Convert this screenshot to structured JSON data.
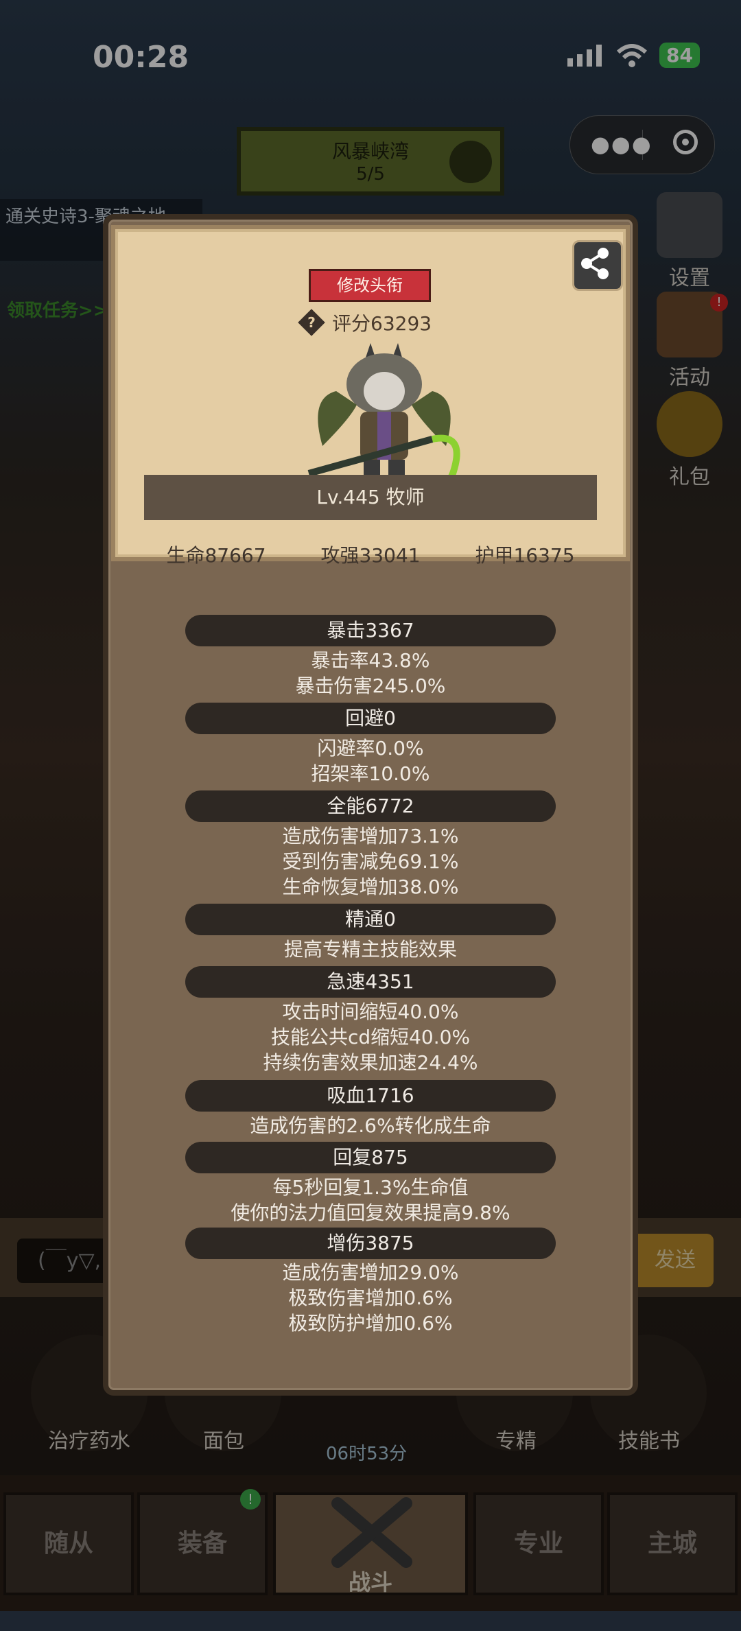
{
  "status": {
    "time": "00:28",
    "battery": "84"
  },
  "map": {
    "name": "风暴峡湾",
    "progress": "5/5"
  },
  "quest": {
    "text": "通关史诗3-聚魂之地",
    "link": "领取任务>>"
  },
  "side": {
    "settings": "设置",
    "activity": "活动",
    "gift": "礼包",
    "activity_badge": "!"
  },
  "chat": {
    "input_value": "(￣y▽,",
    "send": "发送"
  },
  "quick": {
    "potion": "治疗药水",
    "bread": "面包",
    "spec": "专精",
    "skillbook": "技能书",
    "timer": "06时53分"
  },
  "nav": {
    "followers": "随从",
    "equipment": "装备",
    "battle": "战斗",
    "profession": "专业",
    "city": "主城",
    "equipment_badge": "!"
  },
  "hero": {
    "title_button": "修改头衔",
    "score": "评分63293",
    "level_class": "Lv.445 牧师",
    "hp": "生命87667",
    "atk": "攻强33041",
    "armor": "护甲16375"
  },
  "stats": {
    "crit": {
      "head": "暴击3367",
      "lines": [
        "暴击率43.8%",
        "暴击伤害245.0%"
      ]
    },
    "dodge": {
      "head": "回避0",
      "lines": [
        "闪避率0.0%",
        "招架率10.0%"
      ]
    },
    "versatility": {
      "head": "全能6772",
      "lines": [
        "造成伤害增加73.1%",
        "受到伤害减免69.1%",
        "生命恢复增加38.0%"
      ]
    },
    "mastery": {
      "head": "精通0",
      "lines": [
        "提高专精主技能效果"
      ]
    },
    "haste": {
      "head": "急速4351",
      "lines": [
        "攻击时间缩短40.0%",
        "技能公共cd缩短40.0%",
        "持续伤害效果加速24.4%"
      ]
    },
    "leech": {
      "head": "吸血1716",
      "lines": [
        "造成伤害的2.6%转化成生命"
      ]
    },
    "regen": {
      "head": "回复875",
      "lines": [
        "每5秒回复1.3%生命值",
        "使你的法力值回复效果提高9.8%"
      ]
    },
    "dmg_up": {
      "head": "增伤3875",
      "lines": [
        "造成伤害增加29.0%",
        "极致伤害增加0.6%",
        "极致防护增加0.6%"
      ]
    }
  }
}
